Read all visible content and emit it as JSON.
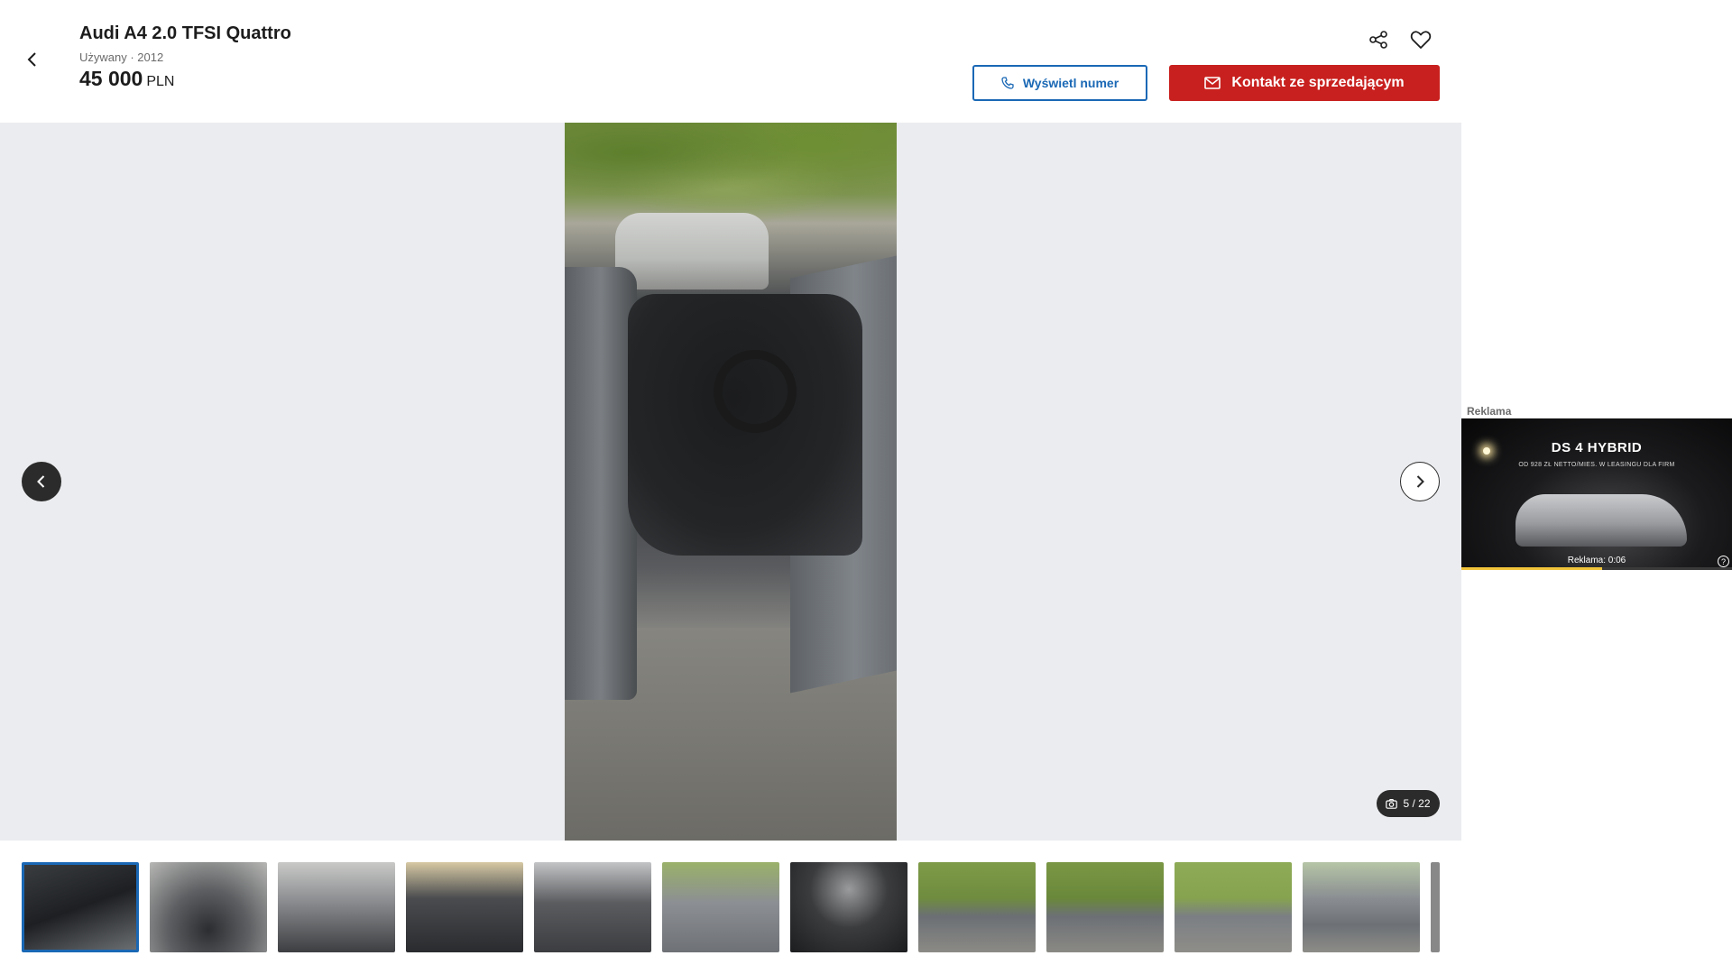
{
  "listing": {
    "title": "Audi A4 2.0 TFSI Quattro",
    "subtitle": "Używany · 2012",
    "price_value": "45 000",
    "price_currency": "PLN"
  },
  "actions": {
    "phone_label": "Wyświetl numer",
    "contact_label": "Kontakt ze sprzedającym",
    "share_icon": "share-icon",
    "favorite_icon": "heart-icon",
    "back_icon": "chevron-left-icon"
  },
  "gallery": {
    "counter": "5 / 22",
    "current_index": 5,
    "total": 22,
    "thumbnails": [
      {
        "alt": "Zdjęcie 1",
        "active": true
      },
      {
        "alt": "Zdjęcie 2",
        "active": false
      },
      {
        "alt": "Zdjęcie 3",
        "active": false
      },
      {
        "alt": "Zdjęcie 4",
        "active": false
      },
      {
        "alt": "Zdjęcie 5",
        "active": false
      },
      {
        "alt": "Zdjęcie 6",
        "active": false
      },
      {
        "alt": "Zdjęcie 7",
        "active": false
      },
      {
        "alt": "Zdjęcie 8",
        "active": false
      },
      {
        "alt": "Zdjęcie 9",
        "active": false
      },
      {
        "alt": "Zdjęcie 10",
        "active": false
      },
      {
        "alt": "Zdjęcie 11",
        "active": false
      },
      {
        "alt": "Zdjęcie 12",
        "active": false
      }
    ]
  },
  "ad": {
    "label": "Reklama",
    "headline": "DS 4 HYBRID",
    "tagline": "OD 928 ZŁ NETTO/MIES. W LEASINGU DLA FIRM",
    "timer": "Reklama: 0:06",
    "progress": 0.52
  },
  "colors": {
    "accent_blue": "#1a68b5",
    "primary_red": "#c8201e",
    "gallery_bg": "#ebecef"
  }
}
